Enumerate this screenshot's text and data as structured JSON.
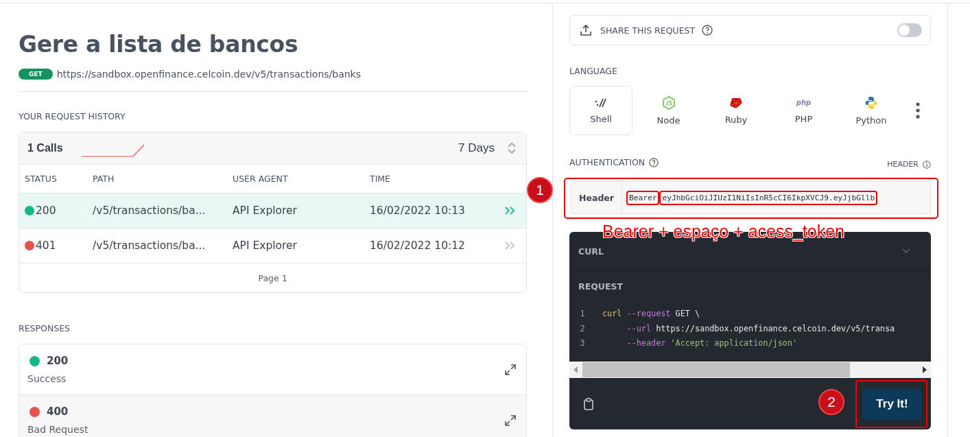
{
  "title": "Gere a lista de bancos",
  "endpoint": {
    "method": "GET",
    "url": "https://sandbox.openfinance.celcoin.dev/v5/transactions/banks"
  },
  "history": {
    "heading": "YOUR REQUEST HISTORY",
    "calls": "1 Calls",
    "range": "7 Days",
    "columns": [
      "STATUS",
      "PATH",
      "USER AGENT",
      "TIME"
    ],
    "rows": [
      {
        "status": "200",
        "color": "#12b886",
        "path": "/v5/transactions/ba...",
        "agent": "API Explorer",
        "time": "16/02/2022 10:13",
        "selected": true
      },
      {
        "status": "401",
        "color": "#e5534b",
        "path": "/v5/transactions/ba...",
        "agent": "API Explorer",
        "time": "16/02/2022 10:12",
        "selected": false
      }
    ],
    "footer": "Page 1"
  },
  "responses": {
    "heading": "RESPONSES",
    "items": [
      {
        "code": "200",
        "color": "#12b886",
        "label": "Success"
      },
      {
        "code": "400",
        "color": "#e5534b",
        "label": "Bad Request"
      }
    ]
  },
  "share": {
    "label": "SHARE THIS REQUEST",
    "on": false
  },
  "language": {
    "heading": "LANGUAGE",
    "items": [
      {
        "name": "Shell",
        "kind": "shell",
        "selected": true
      },
      {
        "name": "Node",
        "kind": "node",
        "selected": false
      },
      {
        "name": "Ruby",
        "kind": "ruby",
        "selected": false
      },
      {
        "name": "PHP",
        "kind": "php",
        "icon_text": "php",
        "selected": false
      },
      {
        "name": "Python",
        "kind": "python",
        "selected": false
      }
    ]
  },
  "auth": {
    "heading": "AUTHENTICATION",
    "mode": "HEADER",
    "key": "Header",
    "scheme": "Bearer",
    "token": "eyJhbGciOiJIUzI1NiIsInR5cCI6IkpXVCJ9.eyJjbGllb"
  },
  "code": {
    "language": "CURL",
    "heading": "REQUEST",
    "lines": [
      {
        "number": "1",
        "tokens": [
          {
            "t": "curl",
            "kind": "cmd"
          },
          {
            "t": " --request",
            "kind": "flag"
          },
          {
            "t": " GET \\",
            "kind": "plain"
          }
        ]
      },
      {
        "number": "2",
        "tokens": [
          {
            "t": "     --url",
            "kind": "flag"
          },
          {
            "t": " https://sandbox.openfinance.celcoin.dev/v5/transa",
            "kind": "plain"
          }
        ]
      },
      {
        "number": "3",
        "tokens": [
          {
            "t": "     --header",
            "kind": "flag"
          },
          {
            "t": " 'Accept: application/json'",
            "kind": "string"
          }
        ]
      }
    ],
    "button": "Try It!"
  },
  "annotations": {
    "markers": [
      "1",
      "2"
    ],
    "callout": "Bearer + espaço + acess_token"
  }
}
